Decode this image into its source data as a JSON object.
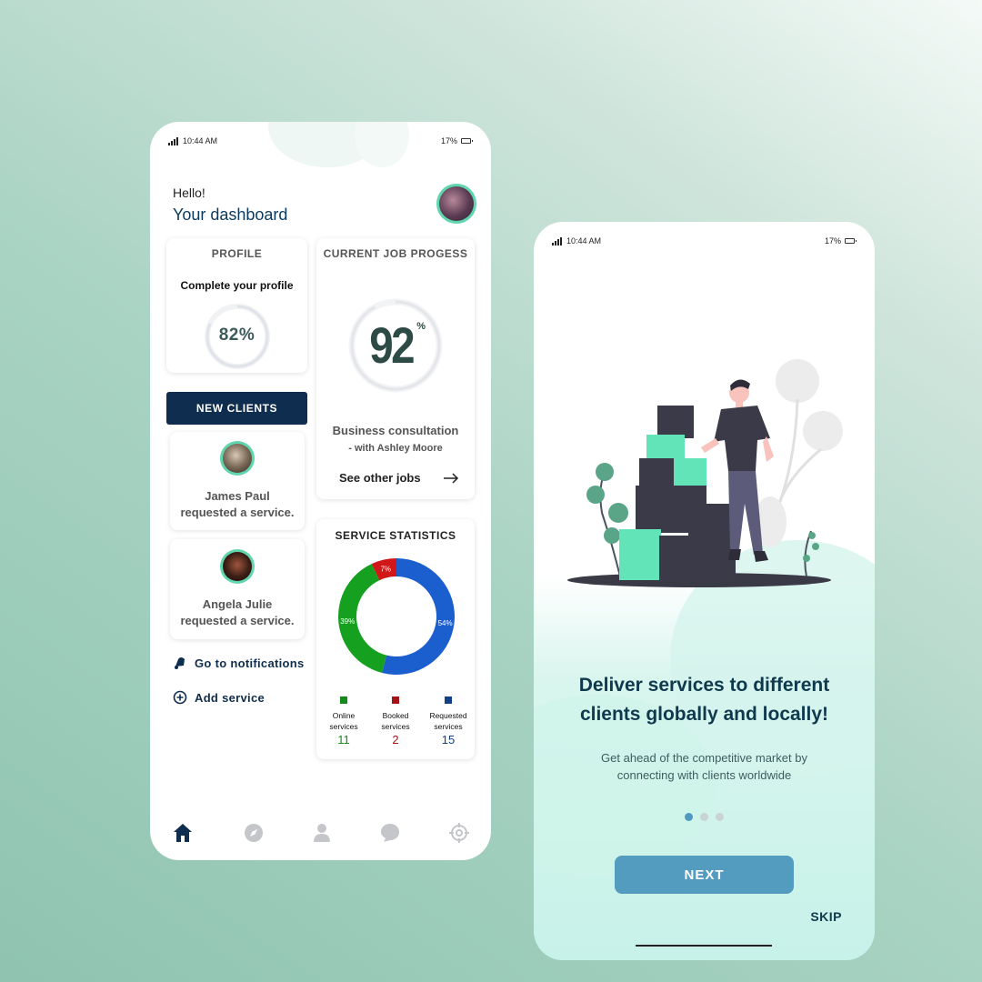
{
  "phone1": {
    "status": {
      "time": "10:44 AM",
      "battery": "17%"
    },
    "greeting": "Hello!",
    "title": "Your dashboard",
    "avatar_icon": "user-avatar",
    "profile_card": {
      "title": "PROFILE",
      "subtitle": "Complete your profile",
      "percent": "82%",
      "progress": 0.82
    },
    "job_card": {
      "title": "CURRENT JOB PROGESS",
      "value": "92",
      "unit": "%",
      "progress": 0.92,
      "job": "Business consultation",
      "with": "- with Ashley Moore",
      "link": "See other jobs"
    },
    "new_clients_label": "NEW CLIENTS",
    "clients": [
      {
        "name": "James Paul",
        "action": "requested a service."
      },
      {
        "name": "Angela Julie",
        "action": "requested a service."
      }
    ],
    "links": {
      "notifications": "Go to notifications",
      "add_service": "Add service"
    },
    "stats_card": {
      "title": "SERVICE STATISTICS",
      "legend": [
        {
          "label_line1": "Online",
          "label_line2": "services",
          "count": "11",
          "color": "#138a1c"
        },
        {
          "label_line1": "Booked",
          "label_line2": "services",
          "count": "2",
          "color": "#a31515"
        },
        {
          "label_line1": "Requested",
          "label_line2": "services",
          "count": "15",
          "color": "#123f86"
        }
      ]
    },
    "bottom_nav": [
      "home-icon",
      "compass-icon",
      "user-icon",
      "chat-icon",
      "target-icon"
    ]
  },
  "chart_data": {
    "type": "pie",
    "title": "SERVICE STATISTICS",
    "categories": [
      "Requested services",
      "Online services",
      "Booked services"
    ],
    "values": [
      54,
      39,
      7
    ],
    "labels": [
      "54%",
      "39%",
      "7%"
    ],
    "colors": [
      "#1b5fcf",
      "#16a01f",
      "#d11717"
    ]
  },
  "phone2": {
    "status": {
      "time": "10:44 AM",
      "battery": "17%"
    },
    "headline_line1": "Deliver services to different",
    "headline_line2": "clients globally and locally!",
    "sub_line1": "Get ahead of the competitive market by",
    "sub_line2": "connecting with clients worldwide",
    "page_index": 1,
    "page_count": 3,
    "next_label": "NEXT",
    "skip_label": "SKIP"
  }
}
